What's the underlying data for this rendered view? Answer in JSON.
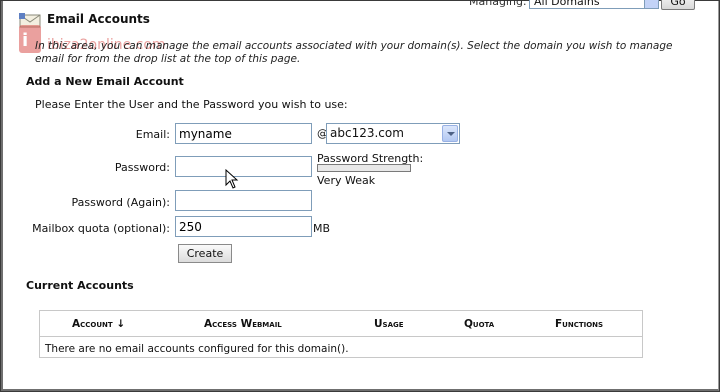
{
  "header": {
    "managing_label": "Managing:",
    "managing_value": "All Domains",
    "go_label": "Go",
    "title": "Email Accounts",
    "watermark_text": "ibiza2online.com",
    "intro": "In this area, you can manage the email accounts associated with your domain(s). Select the domain you wish to manage email for from the drop list at the top of this page."
  },
  "add_account": {
    "heading": "Add a New Email Account",
    "instructions": "Please Enter the User and the Password you wish to use:",
    "email_label": "Email:",
    "email_value": "myname",
    "at_symbol": "@",
    "domain_value": "abc123.com",
    "password_label": "Password:",
    "password_value": "",
    "password_strength_label": "Password Strength:",
    "password_strength_value": "Very Weak",
    "password_strength_level": 0,
    "password_again_label": "Password (Again):",
    "password_again_value": "",
    "quota_label": "Mailbox quota (optional):",
    "quota_value": "250",
    "quota_unit": "MB",
    "create_label": "Create"
  },
  "current_accounts": {
    "heading": "Current Accounts",
    "columns": [
      "Account ↓",
      "Access Webmail",
      "Usage",
      "Quota",
      "Functions"
    ],
    "empty_message": "There are no email accounts configured for this domain()."
  }
}
